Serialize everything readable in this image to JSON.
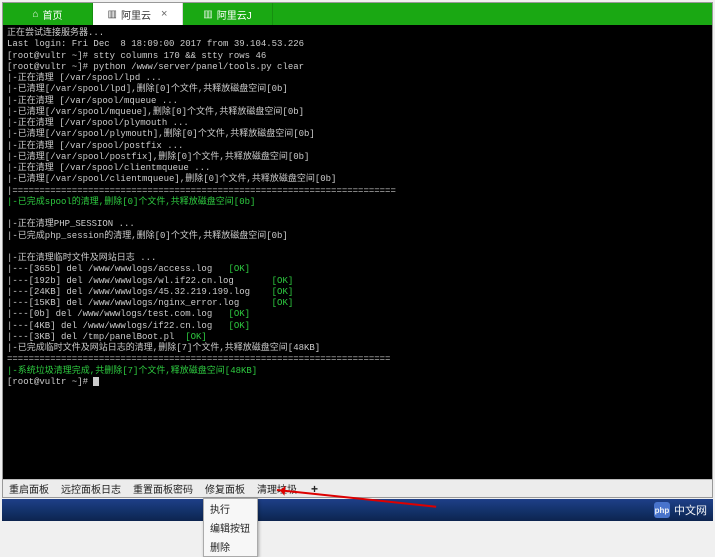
{
  "tabs": [
    {
      "label": "首页",
      "icon": "⌂"
    },
    {
      "label": "阿里云",
      "icon": "▥",
      "close": "×"
    },
    {
      "label": "阿里云J",
      "icon": "▥"
    }
  ],
  "terminal": {
    "lines": [
      {
        "cls": "w",
        "text": "正在尝试连接服务器..."
      },
      {
        "cls": "w",
        "text": "Last login: Fri Dec  8 18:09:00 2017 from 39.104.53.226"
      },
      {
        "cls": "w",
        "text": "[root@vultr ~]# stty columns 170 && stty rows 46"
      },
      {
        "cls": "w",
        "text": "[root@vultr ~]# python /www/server/panel/tools.py clear"
      },
      {
        "cls": "w",
        "text": "|-正在清理 [/var/spool/lpd ..."
      },
      {
        "cls": "w",
        "text": "|-已清理[/var/spool/lpd],删除[0]个文件,共释放磁盘空间[0b]"
      },
      {
        "cls": "w",
        "text": "|-正在清理 [/var/spool/mqueue ..."
      },
      {
        "cls": "w",
        "text": "|-已清理[/var/spool/mqueue],删除[0]个文件,共释放磁盘空间[0b]"
      },
      {
        "cls": "w",
        "text": "|-正在清理 [/var/spool/plymouth ..."
      },
      {
        "cls": "w",
        "text": "|-已清理[/var/spool/plymouth],删除[0]个文件,共释放磁盘空间[0b]"
      },
      {
        "cls": "w",
        "text": "|-正在清理 [/var/spool/postfix ..."
      },
      {
        "cls": "w",
        "text": "|-已清理[/var/spool/postfix],删除[0]个文件,共释放磁盘空间[0b]"
      },
      {
        "cls": "w",
        "text": "|-正在清理 [/var/spool/clientmqueue ..."
      },
      {
        "cls": "w",
        "text": "|-已清理[/var/spool/clientmqueue],删除[0]个文件,共释放磁盘空间[0b]"
      },
      {
        "cls": "w",
        "text": "|======================================================================="
      },
      {
        "cls": "g",
        "text": "|-已完成spool的清理,删除[0]个文件,共释放磁盘空间[0b]"
      },
      {
        "cls": "w",
        "text": ""
      },
      {
        "cls": "w",
        "text": "|-正在清理PHP_SESSION ..."
      },
      {
        "cls": "w",
        "text": "|-已完成php_session的清理,删除[0]个文件,共释放磁盘空间[0b]"
      },
      {
        "cls": "w",
        "text": ""
      },
      {
        "cls": "w",
        "text": "|-正在清理临时文件及网站日志 ..."
      },
      {
        "cls": "mix",
        "pre": "|---[365b] del /www/wwwlogs/access.log   ",
        "ok": "[OK]"
      },
      {
        "cls": "mix",
        "pre": "|---[192b] del /www/wwwlogs/wl.if22.cn.log       ",
        "ok": "[OK]"
      },
      {
        "cls": "mix",
        "pre": "|---[24KB] del /www/wwwlogs/45.32.219.199.log    ",
        "ok": "[OK]"
      },
      {
        "cls": "mix",
        "pre": "|---[15KB] del /www/wwwlogs/nginx_error.log      ",
        "ok": "[OK]"
      },
      {
        "cls": "mix",
        "pre": "|---[0b] del /www/wwwlogs/test.com.log   ",
        "ok": "[OK]"
      },
      {
        "cls": "mix",
        "pre": "|---[4KB] del /www/wwwlogs/if22.cn.log   ",
        "ok": "[OK]"
      },
      {
        "cls": "mix",
        "pre": "|---[3KB] del /tmp/panelBoot.pl  ",
        "ok": "[OK]"
      },
      {
        "cls": "w",
        "text": "|-已完成临时文件及网站日志的清理,删除[7]个文件,共释放磁盘空间[48KB]"
      },
      {
        "cls": "w",
        "text": "======================================================================="
      },
      {
        "cls": "g",
        "text": "|-系统垃圾清理完成,共删除[7]个文件,释放磁盘空间[48KB]"
      },
      {
        "cls": "prompt",
        "text": "[root@vultr ~]# "
      }
    ]
  },
  "toolbar": {
    "items": [
      "重启面板",
      "远控面板日志",
      "重置面板密码",
      "修复面板",
      "清理垃圾"
    ],
    "plus": "+"
  },
  "dropdown": {
    "items": [
      "执行",
      "编辑按钮",
      "删除"
    ]
  },
  "watermark": {
    "logo": "php",
    "text": "中文网"
  }
}
